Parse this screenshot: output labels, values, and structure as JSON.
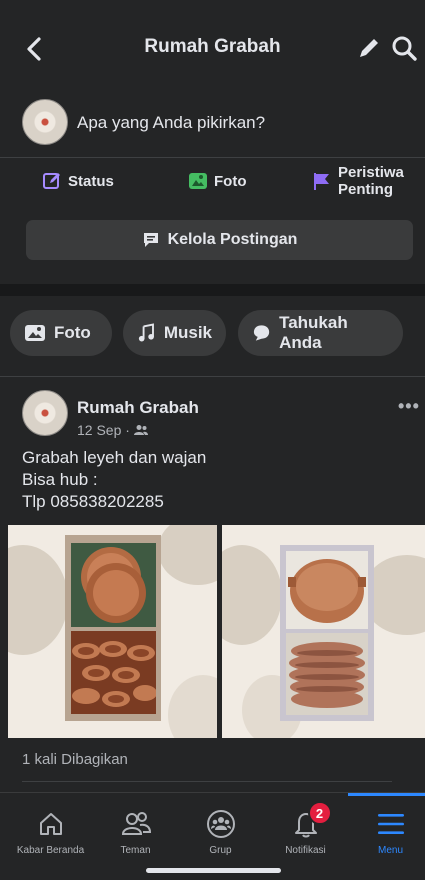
{
  "header": {
    "title": "Rumah Grabah"
  },
  "composer": {
    "prompt": "Apa yang Anda pikirkan?"
  },
  "actions": {
    "status": "Status",
    "foto": "Foto",
    "event_line1": "Peristiwa",
    "event_line2": "Penting"
  },
  "manage_posts": "Kelola Postingan",
  "chips": {
    "foto": "Foto",
    "musik": "Musik",
    "tahukah": "Tahukah Anda"
  },
  "post": {
    "author": "Rumah Grabah",
    "date": "12 Sep ·",
    "lines": [
      "Grabah leyeh dan wajan",
      "Bisa hub :",
      "Tlp 085838202285"
    ],
    "shares": "1 kali Dibagikan"
  },
  "tabs": [
    {
      "label": "Kabar Beranda",
      "icon": "home-icon"
    },
    {
      "label": "Teman",
      "icon": "friends-icon"
    },
    {
      "label": "Grup",
      "icon": "groups-icon"
    },
    {
      "label": "Notifikasi",
      "icon": "bell-icon",
      "badge": "2"
    },
    {
      "label": "Menu",
      "icon": "menu-icon"
    }
  ],
  "colors": {
    "accent": "#2d88ff",
    "badge": "#e41e3f",
    "background": "#242526"
  }
}
